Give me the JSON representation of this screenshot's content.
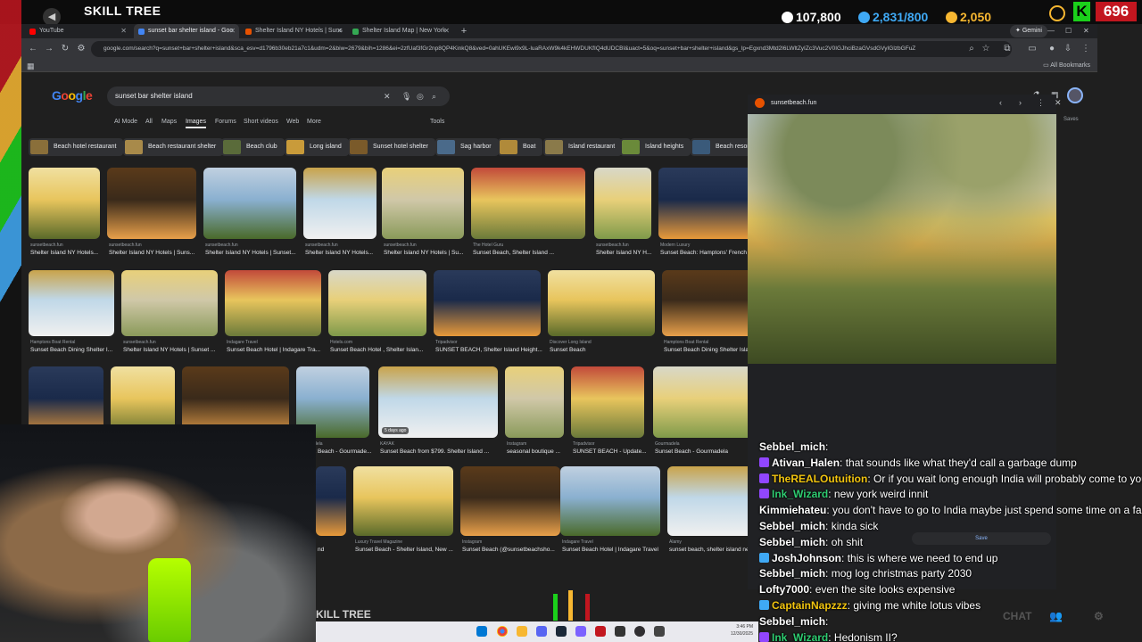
{
  "overlay": {
    "title": "SKILL TREE",
    "hp": "107,800",
    "mana": "2,831/800",
    "coins": "2,050",
    "k_label": "K",
    "red_count": "696",
    "colors": {
      "hp": "#ffffff",
      "mana": "#3fa9f5",
      "coins": "#f7b731"
    }
  },
  "browser": {
    "tabs": [
      {
        "label": "YouTube",
        "color": "#ff0000"
      },
      {
        "label": "sunset bar shelter island - Goo",
        "color": "#4285f4"
      },
      {
        "label": "Shelter Island NY Hotels | Suns",
        "color": "#e65100"
      },
      {
        "label": "Shelter Island Map | New York",
        "color": "#34a853"
      }
    ],
    "gemini": "Gemini",
    "url": "google.com/search?q=sunset+bar+shelter+island&sca_esv=d1796b30eb21a7c1&udm=2&biw=2679&bih=1286&ei=2zfUaf3fGr2np8QP4KinkQ8&ved=0ahUKEwi9x9L-luaRAxW9k4kEHWDUKfIQ4dUDCBI&uact=5&oq=sunset+bar+shelter+island&gs_lp=Egxnd3Mtd2l6LWltZyIZc3Vuc2V0IGJhciBzaGVsdGVyIGlzbGFuZ",
    "all_bookmarks": "All Bookmarks"
  },
  "google": {
    "query": "sunset bar shelter island",
    "filters": [
      "AI Mode",
      "All",
      "Maps",
      "Images",
      "Forums",
      "Short videos",
      "Web",
      "More"
    ],
    "active_filter": "Images",
    "tools": "Tools",
    "saves": "Saves",
    "chips": [
      "Beach hotel restaurant",
      "Beach restaurant shelter",
      "Beach club",
      "Long island",
      "Sunset hotel shelter",
      "Sag harbor",
      "Boat",
      "Island restaurant",
      "Island heights",
      "Beach resort"
    ],
    "row1": [
      {
        "src": "sunsetbeach.fun",
        "title": "Shelter Island NY Hotels..."
      },
      {
        "src": "sunsetbeach.fun",
        "title": "Shelter Island NY Hotels | Suns..."
      },
      {
        "src": "sunsetbeach.fun",
        "title": "Shelter Island NY Hotels | Sunset..."
      },
      {
        "src": "sunsetbeach.fun",
        "title": "Shelter Island NY Hotels..."
      },
      {
        "src": "sunsetbeach.fun",
        "title": "Shelter Island NY Hotels | Su..."
      },
      {
        "src": "The Hotel Guru",
        "title": "Sunset Beach, Shelter Island ..."
      },
      {
        "src": "sunsetbeach.fun",
        "title": "Shelter Island NY H..."
      },
      {
        "src": "Modern Luxury",
        "title": "Sunset Beach: Hamptons' French R..."
      }
    ],
    "row2": [
      {
        "src": "Hamptons Boat Rental",
        "title": "Sunset Beach Dining Shelter I..."
      },
      {
        "src": "sunsetbeach.fun",
        "title": "Shelter Island NY Hotels | Sunset ..."
      },
      {
        "src": "Indagare Travel",
        "title": "Sunset Beach Hotel | Indagare Tra..."
      },
      {
        "src": "Hotels.com",
        "title": "Sunset Beach Hotel , Shelter Islan..."
      },
      {
        "src": "Tripadvisor",
        "title": "SUNSET BEACH, Shelter Island Height..."
      },
      {
        "src": "Discover Long Island",
        "title": "Sunset Beach"
      },
      {
        "src": "Hamptons Boat Rental",
        "title": "Sunset Beach Dining Shelter Islan..."
      }
    ],
    "row3": [
      {
        "src": "",
        "title": ""
      },
      {
        "src": "",
        "title": ""
      },
      {
        "src": "",
        "title": ""
      },
      {
        "src": "Gourmadela",
        "title": "Sunset Beach - Gourmade..."
      },
      {
        "src": "KAYAK",
        "title": "Sunset Beach from $799. Shelter Island ..."
      },
      {
        "src": "Instagram",
        "title": "seasonal boutique ..."
      },
      {
        "src": "Tripadvisor",
        "title": "SUNSET BEACH - Update..."
      },
      {
        "src": "Gourmadela",
        "title": "Sunset Beach - Gourmadela"
      }
    ],
    "kayak_badge": "5 days ago",
    "row4": [
      {
        "src": "",
        "title": "nd"
      },
      {
        "src": "Luxury Travel Magazine",
        "title": "Sunset Beach - Shelter Island, New ..."
      },
      {
        "src": "Instagram",
        "title": "Sunset Beach (@sunsetbeachsho..."
      },
      {
        "src": "Indagare Travel",
        "title": "Sunset Beach Hotel | Indagare Travel"
      },
      {
        "src": "Alamy",
        "title": "sunset beach, shelter island new..."
      }
    ],
    "panel_site": "sunsetbeach.fun",
    "panel_save": "Save"
  },
  "stream": {
    "skill_tree_footer": "KILL TREE",
    "chat_label": "CHAT",
    "taskbar_time": "3:46 PM",
    "taskbar_date": "12/30/2025"
  },
  "chat": [
    {
      "user": "Sebbel_mich",
      "text": "",
      "color": "#ffffff",
      "badge": ""
    },
    {
      "user": "Ativan_Halen",
      "text": "that sounds like what they'd call a garbage dump",
      "color": "#ffffff",
      "badge": "#9146ff"
    },
    {
      "user": "TheREALOutuition",
      "text": "Or if you wait long enough India will probably come to you",
      "color": "#f1c40f",
      "badge": "#9146ff"
    },
    {
      "user": "Ink_Wizard",
      "text": "new york weird innit",
      "color": "#2ecc71",
      "badge": "#9146ff"
    },
    {
      "user": "Kimmiehateu",
      "text": "you don't have to go to India maybe just spend some time on a farm",
      "color": "#ffffff",
      "badge": ""
    },
    {
      "user": "Sebbel_mich",
      "text": "kinda sick",
      "color": "#ffffff",
      "badge": ""
    },
    {
      "user": "Sebbel_mich",
      "text": "oh shit",
      "color": "#ffffff",
      "badge": ""
    },
    {
      "user": "JoshJohnson",
      "text": "this is where we need to end up",
      "color": "#ffffff",
      "badge": "#3fa9f5"
    },
    {
      "user": "Sebbel_mich",
      "text": "mog log christmas party 2030",
      "color": "#ffffff",
      "badge": ""
    },
    {
      "user": "Lofty7000",
      "text": "even the site looks expensive",
      "color": "#ffffff",
      "badge": ""
    },
    {
      "user": "CaptainNapzzz",
      "text": "giving me white lotus vibes",
      "color": "#f1c40f",
      "badge": "#3fa9f5"
    },
    {
      "user": "Sebbel_mich",
      "text": "",
      "color": "#ffffff",
      "badge": ""
    },
    {
      "user": "Ink_Wizard",
      "text": "Hedonism II?",
      "color": "#2ecc71",
      "badge": "#9146ff"
    }
  ]
}
